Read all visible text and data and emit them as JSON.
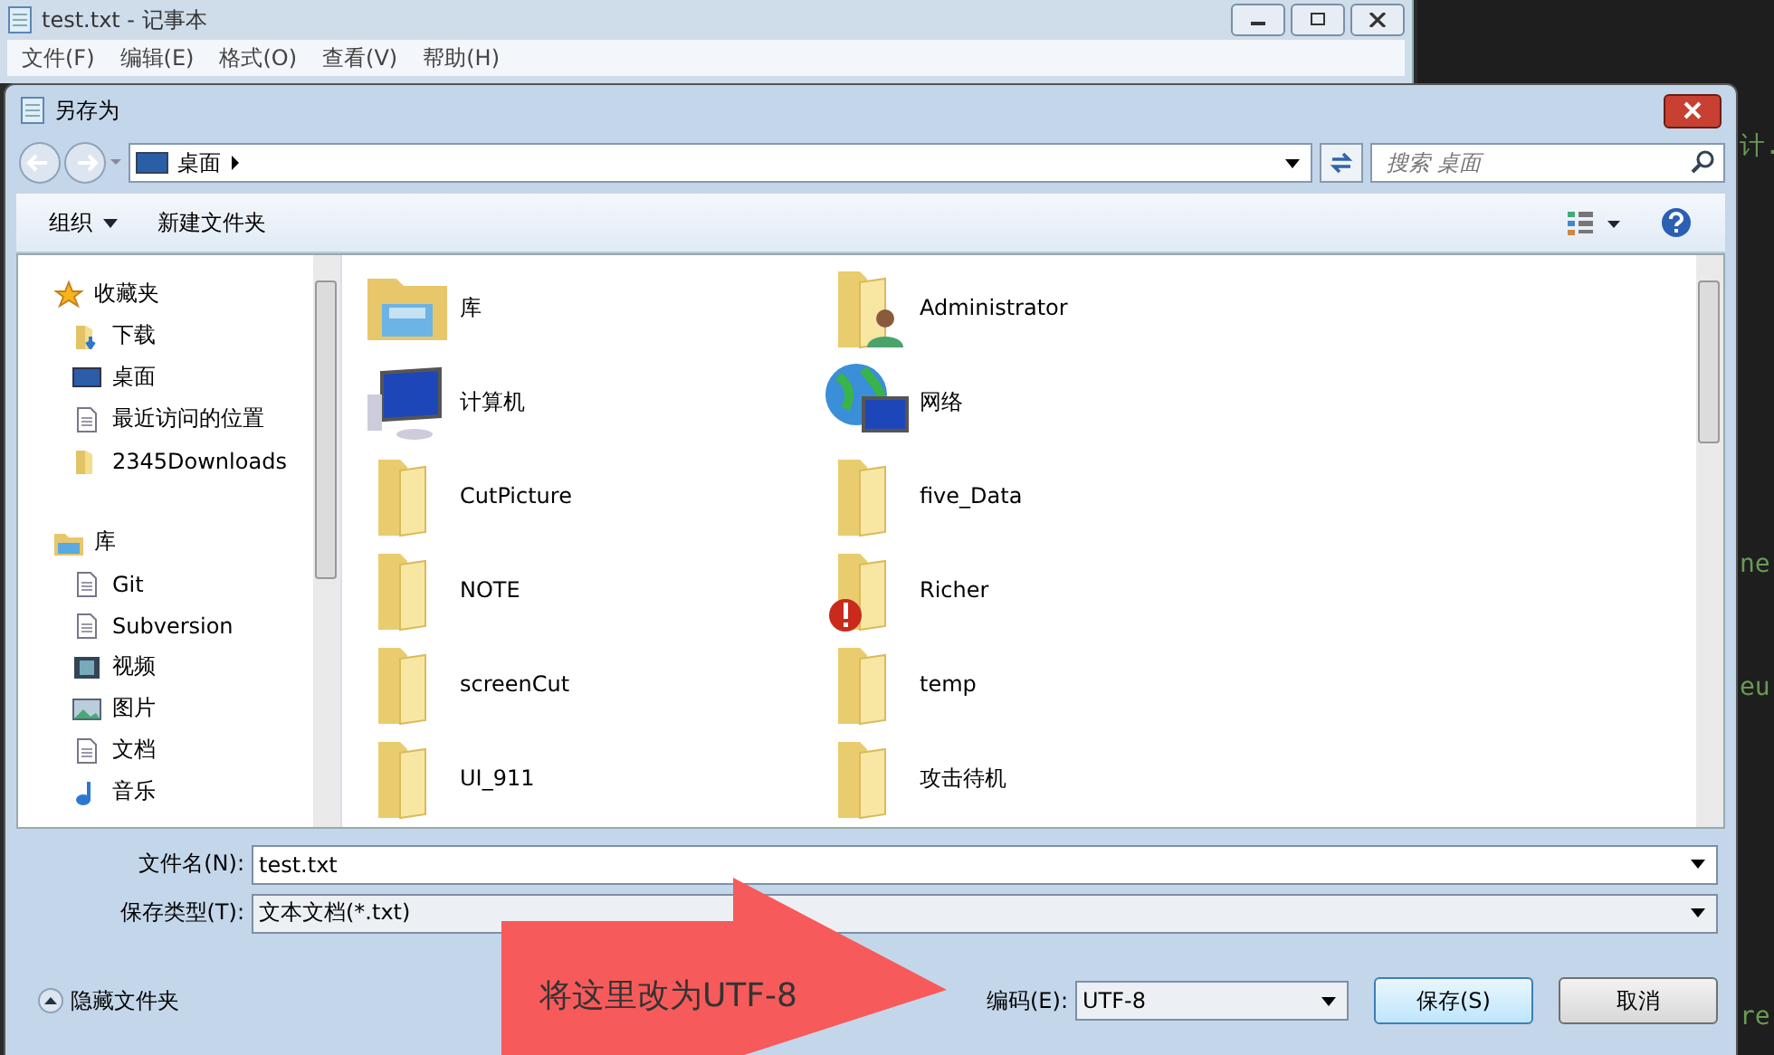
{
  "notepad": {
    "title": "test.txt - 记事本",
    "menu": [
      "文件(F)",
      "编辑(E)",
      "格式(O)",
      "查看(V)",
      "帮助(H)"
    ]
  },
  "editor_fragments": [
    "计.",
    "ne",
    "eu",
    "re"
  ],
  "dialog": {
    "title": "另存为",
    "address": "桌面",
    "search": {
      "placeholder": "搜索 桌面"
    },
    "toolbar": [
      "组织",
      "新建文件夹"
    ]
  },
  "sidebar": [
    {
      "label": "收藏夹",
      "kind": "star",
      "children": [
        {
          "label": "下载",
          "kind": "download"
        },
        {
          "label": "桌面",
          "kind": "desktop"
        },
        {
          "label": "最近访问的位置",
          "kind": "recent"
        },
        {
          "label": "2345Downloads",
          "kind": "folder"
        }
      ]
    },
    {
      "label": "库",
      "kind": "library",
      "children": [
        {
          "label": "Git",
          "kind": "doc"
        },
        {
          "label": "Subversion",
          "kind": "doc"
        },
        {
          "label": "视频",
          "kind": "video"
        },
        {
          "label": "图片",
          "kind": "picture"
        },
        {
          "label": "文档",
          "kind": "doc"
        },
        {
          "label": "音乐",
          "kind": "music"
        }
      ]
    }
  ],
  "files": [
    {
      "label": "库",
      "kind": "library"
    },
    {
      "label": "Administrator",
      "kind": "user"
    },
    {
      "label": "计算机",
      "kind": "computer"
    },
    {
      "label": "网络",
      "kind": "network"
    },
    {
      "label": "CutPicture",
      "kind": "folder"
    },
    {
      "label": "five_Data",
      "kind": "folder"
    },
    {
      "label": "NOTE",
      "kind": "folder"
    },
    {
      "label": "Richer",
      "kind": "warning"
    },
    {
      "label": "screenCut",
      "kind": "folder"
    },
    {
      "label": "temp",
      "kind": "folder"
    },
    {
      "label": "UI_911",
      "kind": "folder"
    },
    {
      "label": "攻击待机",
      "kind": "folder"
    }
  ],
  "form": {
    "filename_label": "文件名(N):",
    "filename": "test.txt",
    "type_label": "保存类型(T):",
    "type": "文本文档(*.txt)",
    "hide_folders": "隐藏文件夹",
    "encoding_label": "编码(E):",
    "encoding": "UTF-8",
    "save": "保存(S)",
    "cancel": "取消"
  },
  "annotation": "将这里改为UTF-8"
}
